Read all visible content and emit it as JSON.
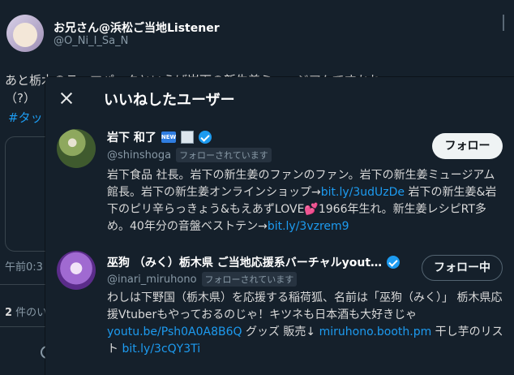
{
  "background_tweet": {
    "author_name": "お兄さん@浜松ご当地Listener",
    "author_handle": "@O_Ni_I_Sa_N",
    "text_line1": "あと栃木のテーマパークといえば岩下の新生姜ミュージアムですかね",
    "text_line2": "（?）",
    "hashtag": "#タッ",
    "time": "午前0:3",
    "likes_count": "2",
    "likes_label": " 件のいいね"
  },
  "modal": {
    "title": "いいねしたユーザー",
    "users": [
      {
        "name": "岩下 和了",
        "new_badge": "NEW",
        "handle": "@shinshoga",
        "follows_you": "フォローされています",
        "button": "フォロー",
        "bio_parts": [
          {
            "text": "岩下食品 社長。岩下の新生姜のファンのファン。岩下の新生姜ミュージアム館長。岩下の新生姜オンラインショップ→",
            "link": false
          },
          {
            "text": "bit.ly/3udUzDe",
            "link": true
          },
          {
            "text": " 岩下の新生姜&岩下のピリ辛らっきょう&もえあずLOVE",
            "link": false
          },
          {
            "text": "💕",
            "heart": true
          },
          {
            "text": "1966年生れ。新生姜レシピRT多め。40年分の音盤ベストテン→",
            "link": false
          },
          {
            "text": "bit.ly/3vzrem9",
            "link": true
          }
        ]
      },
      {
        "name": "巫狗 （みく）栃木県 ご当地応援系バーチャルyout…",
        "handle": "@inari_miruhono",
        "follows_you": "フォローされています",
        "button": "フォロー中",
        "bio_parts": [
          {
            "text": "わしは下野国（栃木県）を応援する稲荷狐、名前は「巫狗（みく）」 栃木県応援Vtuberもやっておるのじゃ！キツネも日本酒も大好きじゃ",
            "link": false
          },
          {
            "text": "youtu.be/Psh0A0A8B6Q",
            "link": true
          },
          {
            "text": " グッズ 販売↓ ",
            "link": false
          },
          {
            "text": "miruhono.booth.pm",
            "link": true
          },
          {
            "text": " 干し芋のリスト ",
            "link": false
          },
          {
            "text": "bit.ly/3cQY3Ti",
            "link": true
          }
        ]
      }
    ]
  },
  "colors": {
    "background": "#15202b",
    "link": "#1d9bf0",
    "text": "#d9d9d9",
    "muted": "#8899a6"
  }
}
